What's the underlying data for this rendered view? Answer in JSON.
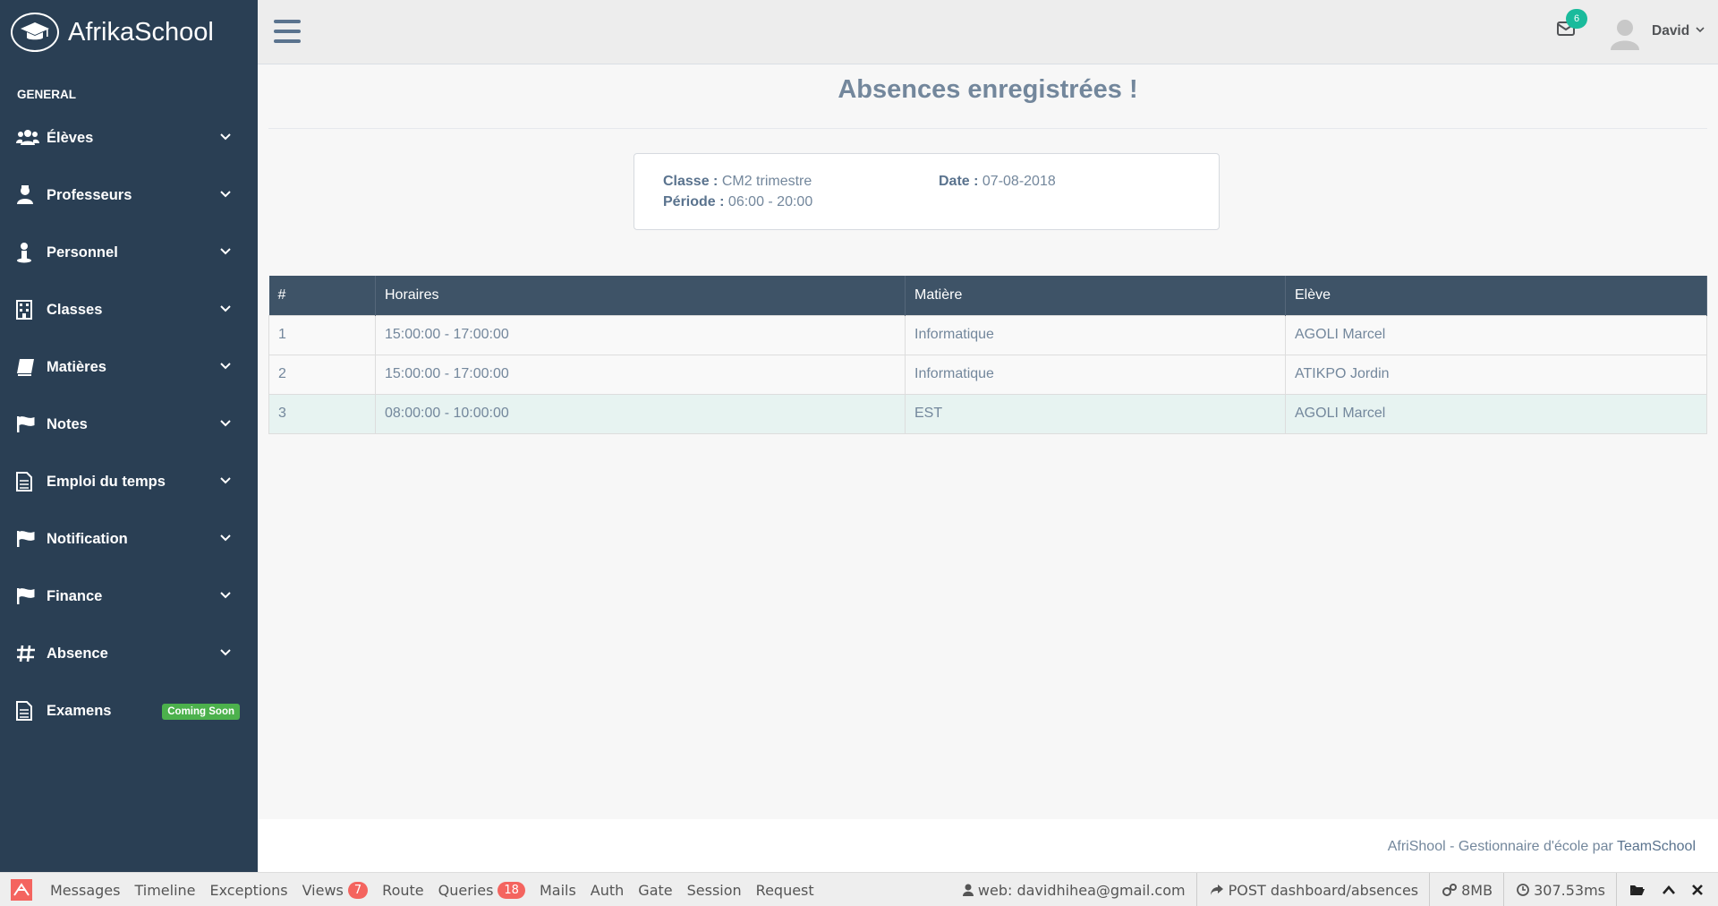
{
  "brand": {
    "name": "AfrikaSchool"
  },
  "sidebar": {
    "section_title": "GENERAL",
    "items": [
      {
        "label": "Élèves",
        "icon": "users-icon"
      },
      {
        "label": "Professeurs",
        "icon": "teacher-icon"
      },
      {
        "label": "Personnel",
        "icon": "staff-icon"
      },
      {
        "label": "Classes",
        "icon": "building-icon"
      },
      {
        "label": "Matières",
        "icon": "book-icon"
      },
      {
        "label": "Notes",
        "icon": "flag-icon"
      },
      {
        "label": "Emploi du temps",
        "icon": "file-icon"
      },
      {
        "label": "Notification",
        "icon": "flag-icon"
      },
      {
        "label": "Finance",
        "icon": "flag-icon"
      },
      {
        "label": "Absence",
        "icon": "hashtag-icon"
      },
      {
        "label": "Examens",
        "icon": "file-icon",
        "badge": "Coming Soon"
      }
    ]
  },
  "topnav": {
    "mail_count": "6",
    "user_name": "David"
  },
  "main": {
    "title": "Absences enregistrées !",
    "info": {
      "classe_label": "Classe :",
      "classe_value": "CM2 trimestre",
      "date_label": "Date :",
      "date_value": "07-08-2018",
      "periode_label": "Période :",
      "periode_value": "06:00 - 20:00"
    },
    "table": {
      "headers": [
        "#",
        "Horaires",
        "Matière",
        "Elève"
      ],
      "rows": [
        [
          "1",
          "15:00:00 - 17:00:00",
          "Informatique",
          "AGOLI Marcel"
        ],
        [
          "2",
          "15:00:00 - 17:00:00",
          "Informatique",
          "ATIKPO Jordin"
        ],
        [
          "3",
          "08:00:00 - 10:00:00",
          "EST",
          "AGOLI Marcel"
        ]
      ]
    }
  },
  "footer": {
    "text": "AfriShool - Gestionnaire d'école par",
    "link": "TeamSchool"
  },
  "debugbar": {
    "tabs": [
      {
        "label": "Messages"
      },
      {
        "label": "Timeline"
      },
      {
        "label": "Exceptions"
      },
      {
        "label": "Views",
        "badge": "7"
      },
      {
        "label": "Route"
      },
      {
        "label": "Queries",
        "badge": "18"
      },
      {
        "label": "Mails"
      },
      {
        "label": "Auth"
      },
      {
        "label": "Gate"
      },
      {
        "label": "Session"
      },
      {
        "label": "Request"
      }
    ],
    "user": "web: davidhihea@gmail.com",
    "route": "POST dashboard/absences",
    "memory": "8MB",
    "time": "307.53ms"
  },
  "colors": {
    "sidebar_bg": "#2a3f54",
    "table_header_bg": "#3e5367",
    "accent": "#1abb9c",
    "badge_green": "#4cb14c",
    "badge_red": "#f4645f"
  }
}
